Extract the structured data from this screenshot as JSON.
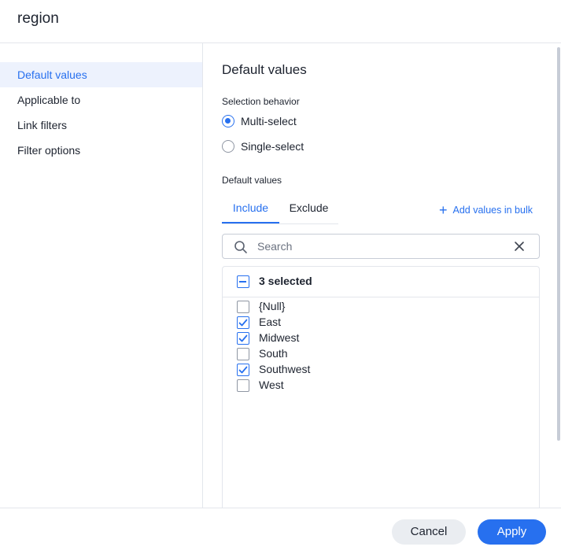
{
  "dialog": {
    "title": "region"
  },
  "sidebar": {
    "items": [
      {
        "label": "Default values",
        "active": true
      },
      {
        "label": "Applicable to",
        "active": false
      },
      {
        "label": "Link filters",
        "active": false
      },
      {
        "label": "Filter options",
        "active": false
      }
    ]
  },
  "main": {
    "title": "Default values",
    "selection_behavior": {
      "label": "Selection behavior",
      "options": [
        {
          "label": "Multi-select",
          "checked": true
        },
        {
          "label": "Single-select",
          "checked": false
        }
      ]
    },
    "default_values_label": "Default values",
    "tabs": [
      {
        "label": "Include",
        "active": true
      },
      {
        "label": "Exclude",
        "active": false
      }
    ],
    "add_bulk_label": "Add values in bulk",
    "search": {
      "placeholder": "Search",
      "value": ""
    },
    "list": {
      "selected_count": "3 selected",
      "options": [
        {
          "label": "{Null}",
          "checked": false
        },
        {
          "label": "East",
          "checked": true
        },
        {
          "label": "Midwest",
          "checked": true
        },
        {
          "label": "South",
          "checked": false
        },
        {
          "label": "Southwest",
          "checked": true
        },
        {
          "label": "West",
          "checked": false
        }
      ]
    }
  },
  "footer": {
    "cancel_label": "Cancel",
    "apply_label": "Apply"
  },
  "colors": {
    "accent": "#2770ef",
    "active_nav_bg": "#edf2fd",
    "border": "#e3e6ec"
  }
}
